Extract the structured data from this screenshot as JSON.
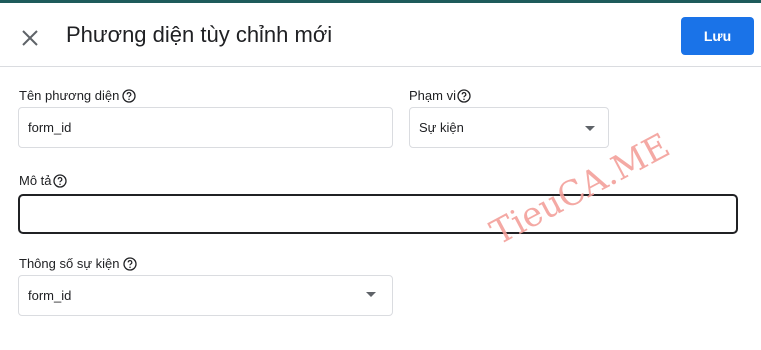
{
  "header": {
    "title": "Phương diện tùy chỉnh mới",
    "save_label": "Lưu",
    "close_icon": "close-icon",
    "accent_color": "#1a73e8"
  },
  "form": {
    "dimension_name": {
      "label": "Tên phương diện",
      "value": "form_id"
    },
    "scope": {
      "label": "Phạm vi",
      "selected": "Sự kiện"
    },
    "description": {
      "label": "Mô tả",
      "value": ""
    },
    "event_parameter": {
      "label": "Thông số sự kiện",
      "selected": "form_id"
    }
  },
  "watermark": {
    "text": "TieuCA.ME"
  }
}
